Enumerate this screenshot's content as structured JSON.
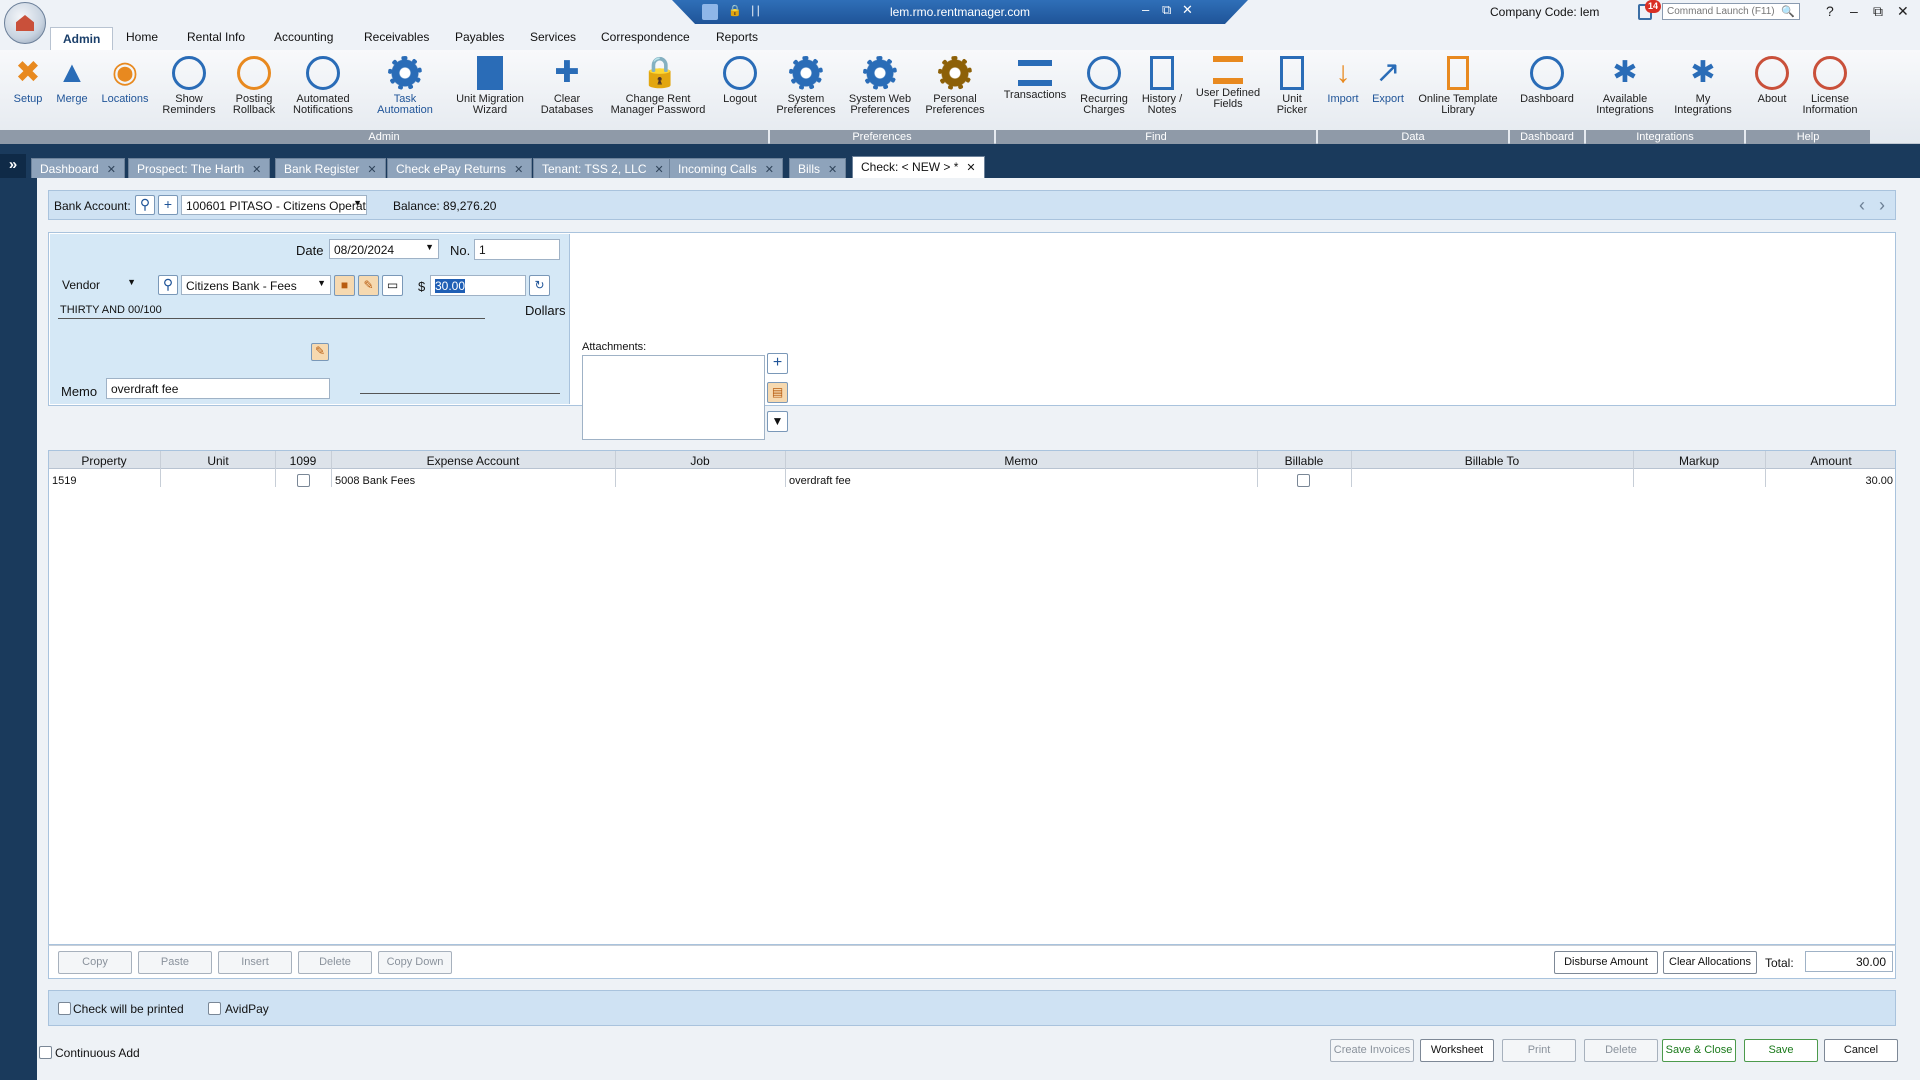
{
  "titlebar": {
    "url": "lem.rmo.rentmanager.com",
    "company_code": "Company Code: lem",
    "notification_count": "14",
    "command_launch_placeholder": "Command Launch (F11)"
  },
  "menu": {
    "tabs": [
      "Admin",
      "Home",
      "Rental Info",
      "Accounting",
      "Receivables",
      "Payables",
      "Services",
      "Correspondence",
      "Reports"
    ],
    "active": "Admin"
  },
  "ribbon": {
    "buttons": [
      {
        "label": "Setup",
        "icon": "tools-icon"
      },
      {
        "label": "Merge",
        "icon": "merge-icon"
      },
      {
        "label": "Locations",
        "icon": "location-pin-icon"
      },
      {
        "label": "Show\nReminders",
        "icon": "alarm-clock-icon"
      },
      {
        "label": "Posting\nRollback",
        "icon": "rollback-icon"
      },
      {
        "label": "Automated\nNotifications",
        "icon": "notification-icon"
      },
      {
        "label": "Task\nAutomation",
        "icon": "gear-icon"
      },
      {
        "label": "Unit Migration\nWizard",
        "icon": "building-icon"
      },
      {
        "label": "Clear\nDatabases",
        "icon": "broom-icon"
      },
      {
        "label": "Change Rent\nManager Password",
        "icon": "lock-icon"
      },
      {
        "label": "Logout",
        "icon": "power-icon"
      },
      {
        "label": "System\nPreferences",
        "icon": "gear-icon"
      },
      {
        "label": "System Web\nPreferences",
        "icon": "web-gear-icon"
      },
      {
        "label": "Personal\nPreferences",
        "icon": "gear-icon"
      },
      {
        "label": "Transactions",
        "icon": "transactions-icon"
      },
      {
        "label": "Recurring\nCharges",
        "icon": "recurring-charges-icon"
      },
      {
        "label": "History /\nNotes",
        "icon": "notes-icon"
      },
      {
        "label": "User Defined\nFields",
        "icon": "fields-icon"
      },
      {
        "label": "Unit\nPicker",
        "icon": "unit-picker-icon"
      },
      {
        "label": "Import",
        "icon": "import-icon"
      },
      {
        "label": "Export",
        "icon": "export-icon"
      },
      {
        "label": "Online Template\nLibrary",
        "icon": "template-library-icon"
      },
      {
        "label": "Dashboard",
        "icon": "gauge-icon"
      },
      {
        "label": "Available\nIntegrations",
        "icon": "puzzle-icon"
      },
      {
        "label": "My\nIntegrations",
        "icon": "puzzle-icon"
      },
      {
        "label": "About",
        "icon": "about-icon"
      },
      {
        "label": "License\nInformation",
        "icon": "license-icon"
      }
    ],
    "groups": [
      "Admin",
      "Preferences",
      "Find",
      "Data",
      "Dashboard",
      "Integrations",
      "Help"
    ]
  },
  "doc_tabs": [
    "Dashboard",
    "Prospect: The Harth",
    "Bank Register",
    "Check ePay Returns",
    "Tenant: TSS 2, LLC",
    "Incoming Calls",
    "Bills",
    "Check: < NEW > *"
  ],
  "bank": {
    "label": "Bank Account:",
    "account": "100601 PITASO - Citizens Operatir",
    "balance": "Balance: 89,276.20"
  },
  "check": {
    "date_label": "Date",
    "date": "08/20/2024",
    "no_label": "No.",
    "number": "1",
    "payee_type": "Vendor",
    "payee": "Citizens Bank - Fees",
    "currency": "$",
    "amount": "30.00",
    "amount_words": "THIRTY AND 00/100",
    "dollars_label": "Dollars",
    "memo_label": "Memo",
    "memo": "overdraft fee",
    "attachments_label": "Attachments:"
  },
  "grid": {
    "columns": [
      "Property",
      "Unit",
      "1099",
      "Expense Account",
      "Job",
      "Memo",
      "Billable",
      "Billable To",
      "Markup",
      "Amount"
    ],
    "rows": [
      {
        "property": "1519",
        "unit": "",
        "is_1099": false,
        "expense_account": "5008 Bank Fees",
        "job": "",
        "memo": "overdraft fee",
        "billable": false,
        "billable_to": "",
        "markup": "",
        "amount": "30.00"
      }
    ]
  },
  "grid_actions": {
    "copy": "Copy",
    "paste": "Paste",
    "insert": "Insert",
    "delete": "Delete",
    "copy_down": "Copy Down",
    "disburse": "Disburse Amount",
    "clear_allocations": "Clear Allocations",
    "total_label": "Total:",
    "total": "30.00"
  },
  "print_options": {
    "check_will_be_printed": "Check will be printed",
    "avidpay": "AvidPay"
  },
  "footer": {
    "continuous_add": "Continuous Add",
    "create_invoices": "Create Invoices",
    "worksheet": "Worksheet",
    "print": "Print",
    "delete": "Delete",
    "save_close": "Save & Close",
    "save": "Save",
    "cancel": "Cancel"
  },
  "colors": {
    "accent": "#1f5498",
    "form_bg": "#d5e8f6",
    "tab_bar": "#1a3a5c"
  }
}
